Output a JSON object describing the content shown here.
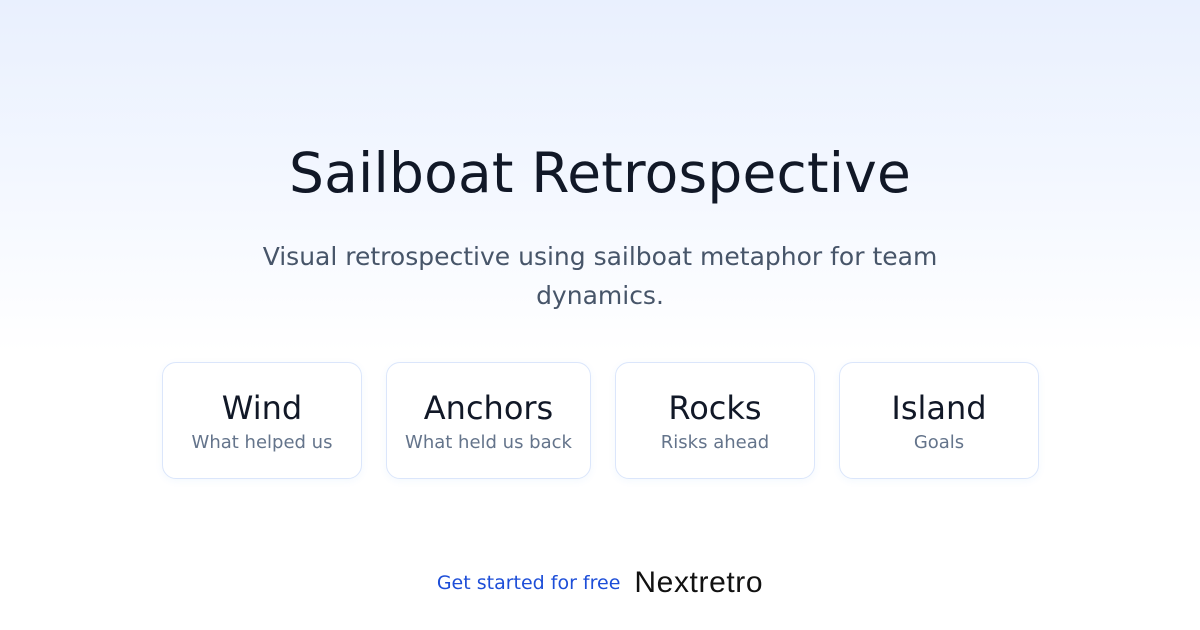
{
  "hero": {
    "title": "Sailboat Retrospective",
    "subtitle": "Visual retrospective using sailboat metaphor for team dynamics."
  },
  "cards": [
    {
      "title": "Wind",
      "description": "What helped us"
    },
    {
      "title": "Anchors",
      "description": "What held us back"
    },
    {
      "title": "Rocks",
      "description": "Risks ahead"
    },
    {
      "title": "Island",
      "description": "Goals"
    }
  ],
  "footer": {
    "cta_label": "Get started for free",
    "brand_name": "Nextretro"
  },
  "colors": {
    "accent": "#1d4ed8",
    "title": "#111827",
    "muted": "#64748b",
    "card_border": "#dbe6fb"
  }
}
